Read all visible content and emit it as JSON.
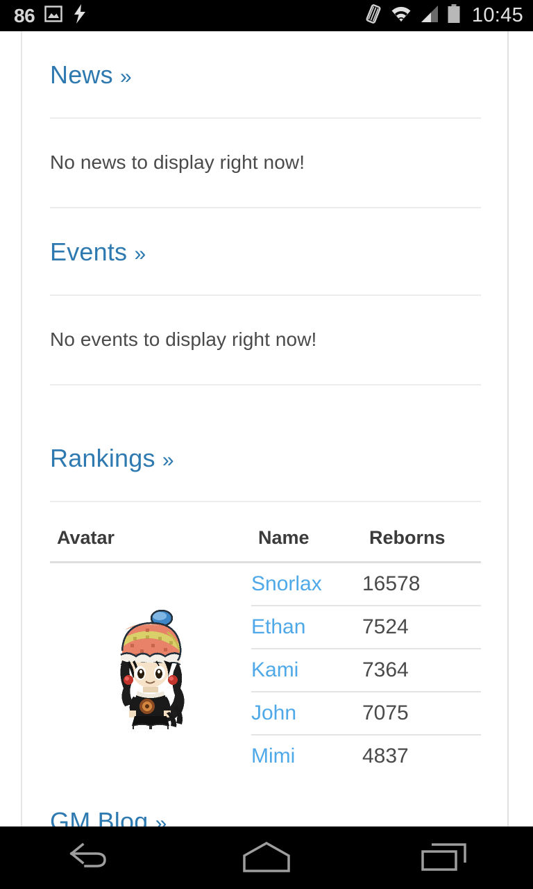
{
  "statusbar": {
    "notification_count": "86",
    "time": "10:45",
    "icons": [
      "image-icon",
      "usb-debugging-icon",
      "vibrate-icon",
      "wifi-icon",
      "cellular-signal-icon",
      "battery-icon"
    ]
  },
  "content": {
    "news": {
      "heading": "News",
      "chevron": "»",
      "empty_text": "No news to display right now!"
    },
    "events": {
      "heading": "Events",
      "chevron": "»",
      "empty_text": "No events to display right now!"
    },
    "rankings": {
      "heading": "Rankings",
      "chevron": "»",
      "columns": [
        "Avatar",
        "Name",
        "Reborns"
      ],
      "rows": [
        {
          "name": "Snorlax",
          "reborns": "16578"
        },
        {
          "name": "Ethan",
          "reborns": "7524"
        },
        {
          "name": "Kami",
          "reborns": "7364"
        },
        {
          "name": "John",
          "reborns": "7075"
        },
        {
          "name": "Mimi",
          "reborns": "4837"
        }
      ],
      "avatar_alt": "pixel-character-avatar"
    },
    "gm_blog": {
      "heading": "GM Blog",
      "chevron": "»"
    }
  },
  "navbar": {
    "back": "back-icon",
    "home": "home-icon",
    "recents": "recent-apps-icon"
  },
  "colors": {
    "heading_link": "#2e7ab0",
    "row_link": "#4fa9e8",
    "body_text": "#4a4a4a",
    "divider": "#ececec",
    "statusbar_bg": "#000000"
  }
}
